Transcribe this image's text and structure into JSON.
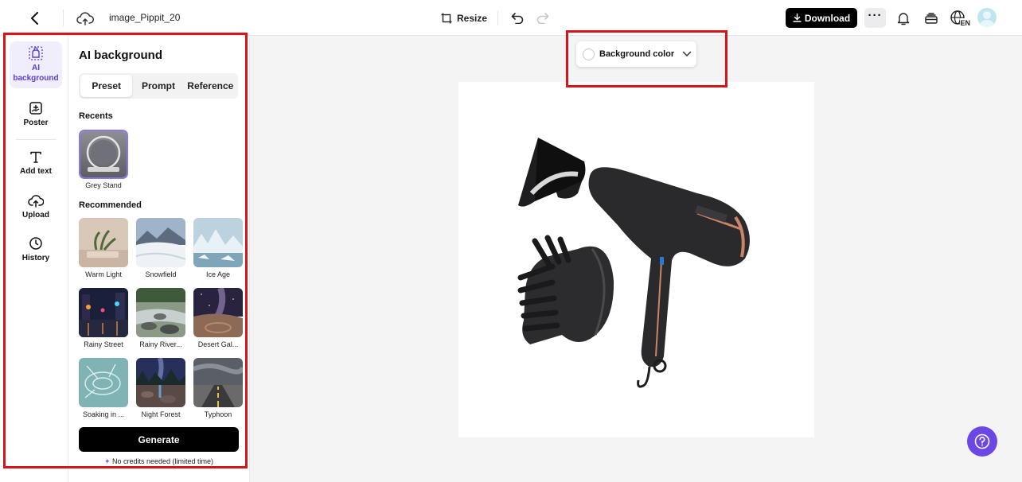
{
  "topbar": {
    "filename": "image_Pippit_20",
    "resize_label": "Resize",
    "download_label": "Download",
    "more_label": "···",
    "lang_code": "EN"
  },
  "rail": {
    "items": [
      {
        "label": "AI background",
        "icon": "ai-background-icon",
        "active": true
      },
      {
        "label": "Poster",
        "icon": "poster-icon"
      },
      {
        "label": "Add text",
        "icon": "text-icon"
      },
      {
        "label": "Upload",
        "icon": "upload-icon"
      },
      {
        "label": "History",
        "icon": "history-icon"
      }
    ]
  },
  "panel": {
    "title": "AI background",
    "tabs": [
      {
        "label": "Preset",
        "active": true
      },
      {
        "label": "Prompt"
      },
      {
        "label": "Reference"
      }
    ],
    "recents_label": "Recents",
    "recents": [
      {
        "label": "Grey Stand"
      }
    ],
    "recommended_label": "Recommended",
    "recommended": [
      {
        "label": "Warm Light"
      },
      {
        "label": "Snowfield"
      },
      {
        "label": "Ice Age"
      },
      {
        "label": "Rainy Street"
      },
      {
        "label": "Rainy River..."
      },
      {
        "label": "Desert Gal..."
      },
      {
        "label": "Soaking in ..."
      },
      {
        "label": "Night Forest"
      },
      {
        "label": "Typhoon"
      }
    ],
    "generate_label": "Generate",
    "credits_note": "No credits needed (limited time)"
  },
  "canvas": {
    "background_color_label": "Background color"
  },
  "colors": {
    "accent": "#6b47e6",
    "highlight": "#d8141b"
  }
}
